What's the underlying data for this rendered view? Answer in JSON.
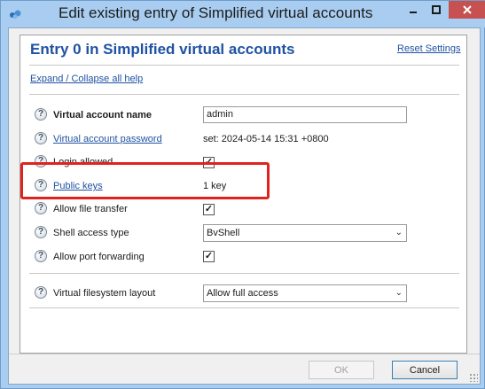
{
  "window": {
    "title": "Edit existing entry of Simplified virtual accounts",
    "minimize_icon": "minimize-icon",
    "maximize_icon": "maximize-icon",
    "close_icon": "close-icon",
    "close_color": "#c75050"
  },
  "panel": {
    "title": "Entry 0 in Simplified virtual accounts",
    "reset_label": "Reset Settings",
    "expand_label": "Expand / Collapse all help"
  },
  "fields": {
    "account_name": {
      "label": "Virtual account name",
      "value": "admin"
    },
    "password": {
      "label": "Virtual account password",
      "value": "set:  2024-05-14 15:31 +0800"
    },
    "login_allowed": {
      "label": "Login allowed",
      "checked": true
    },
    "public_keys": {
      "label": "Public keys",
      "value": "1 key"
    },
    "file_transfer": {
      "label": "Allow file transfer",
      "checked": true
    },
    "shell_access": {
      "label": "Shell access type",
      "value": "BvShell"
    },
    "port_forwarding": {
      "label": "Allow port forwarding",
      "checked": true
    },
    "vfs_layout": {
      "label": "Virtual filesystem layout",
      "value": "Allow full access"
    }
  },
  "buttons": {
    "ok": "OK",
    "cancel": "Cancel"
  },
  "colors": {
    "accent": "#1f52a3",
    "highlight": "#e0231c",
    "frame": "#a9cdf0"
  }
}
